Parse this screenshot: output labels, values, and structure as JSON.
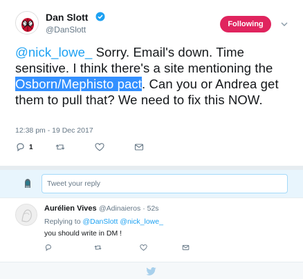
{
  "tweet": {
    "author_name": "Dan Slott",
    "author_handle": "@DanSlott",
    "follow_label": "Following",
    "text_mention": "@nick_lowe_",
    "text_part1": " Sorry. Email's down. Time sensitive. I think there's a site mentioning the ",
    "text_highlight": "Osborn/Mephisto pact",
    "text_part2": ". Can you or Andrea get them to pull that? We need to fix this NOW.",
    "timestamp": "12:38 pm - 19 Dec 2017",
    "reply_count": "1"
  },
  "reply_box": {
    "placeholder": "Tweet your reply"
  },
  "reply": {
    "author_name": "Aurélien Vives",
    "author_handle": "@Adinaieros · 52s",
    "replying_prefix": "Replying to",
    "replying_to_1": "@DanSlott",
    "replying_to_2": "@nick_lowe_",
    "text": "you should write in DM !"
  },
  "colors": {
    "brand_blue": "#1da1f2",
    "follow_pink": "#e0245e",
    "highlight": "#3390ff"
  },
  "icons": [
    "verified-badge-icon",
    "chevron-down-icon",
    "reply-icon",
    "retweet-icon",
    "heart-icon",
    "message-icon",
    "twitter-bird-icon"
  ]
}
